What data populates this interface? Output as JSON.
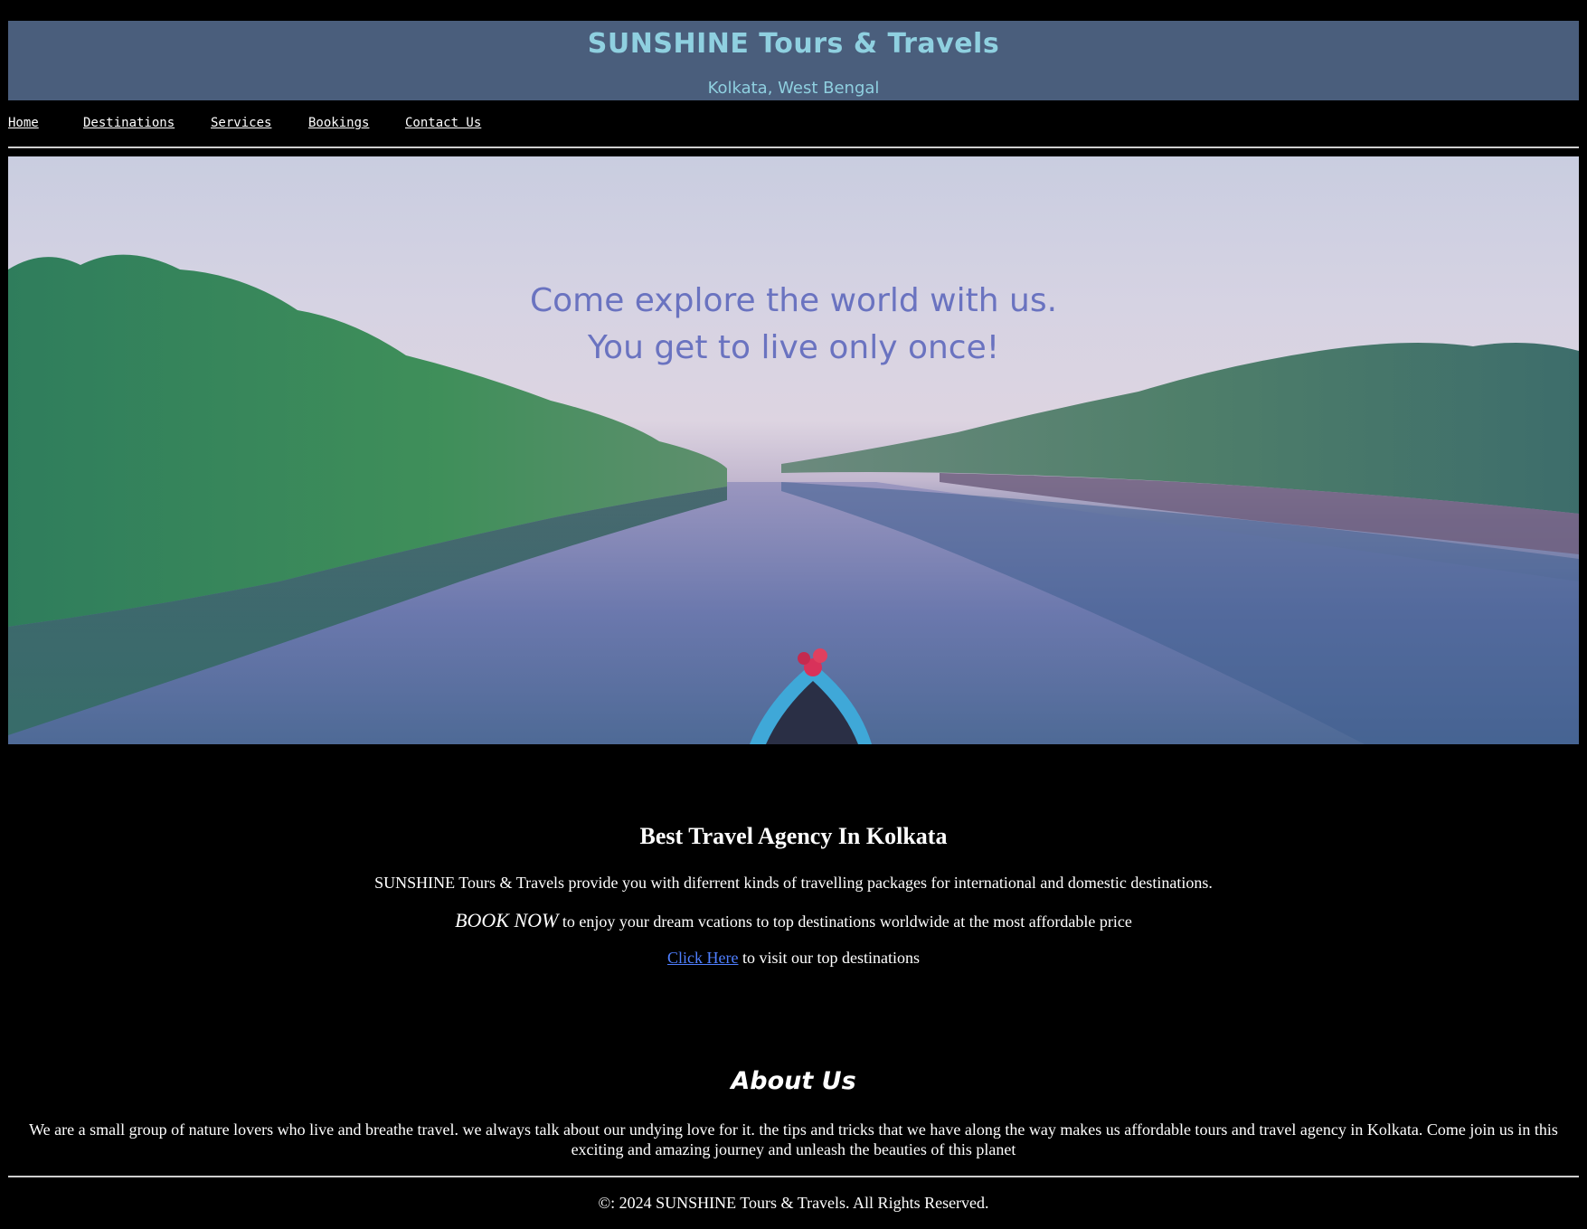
{
  "header": {
    "title": "SUNSHINE Tours & Travels",
    "subtitle": "Kolkata, West Bengal"
  },
  "nav": {
    "items": [
      {
        "label": "Home"
      },
      {
        "label": "Destinations"
      },
      {
        "label": "Services"
      },
      {
        "label": "Bookings"
      },
      {
        "label": "Contact Us"
      }
    ]
  },
  "hero": {
    "tagline_line1": "Come explore the world with us.",
    "tagline_line2": "You get to live only once!"
  },
  "agency": {
    "heading": "Best Travel Agency In Kolkata",
    "description": "SUNSHINE Tours & Travels provide you with diferrent kinds of travelling packages for international and domestic destinations.",
    "book_now": "BOOK NOW",
    "book_now_rest": " to enjoy your dream vcations to top destinations worldwide at the most affordable price",
    "link_text": "Click Here",
    "link_rest": " to visit our top destinations"
  },
  "about": {
    "heading": "About Us",
    "text": "We are a small group of nature lovers who live and breathe travel. we always talk about our undying love for it. the tips and tricks that we have along the way makes us affordable tours and travel agency in Kolkata. Come join us in this exciting and amazing journey and unleash the beauties of this planet"
  },
  "footer": {
    "copyright": "©: 2024 SUNSHINE Tours & Travels. All Rights Reserved."
  },
  "colors": {
    "header_bg": "#4a5e7c",
    "header_text": "#8fd0e0",
    "tagline": "#6a73c0",
    "link": "#4f7fff"
  }
}
